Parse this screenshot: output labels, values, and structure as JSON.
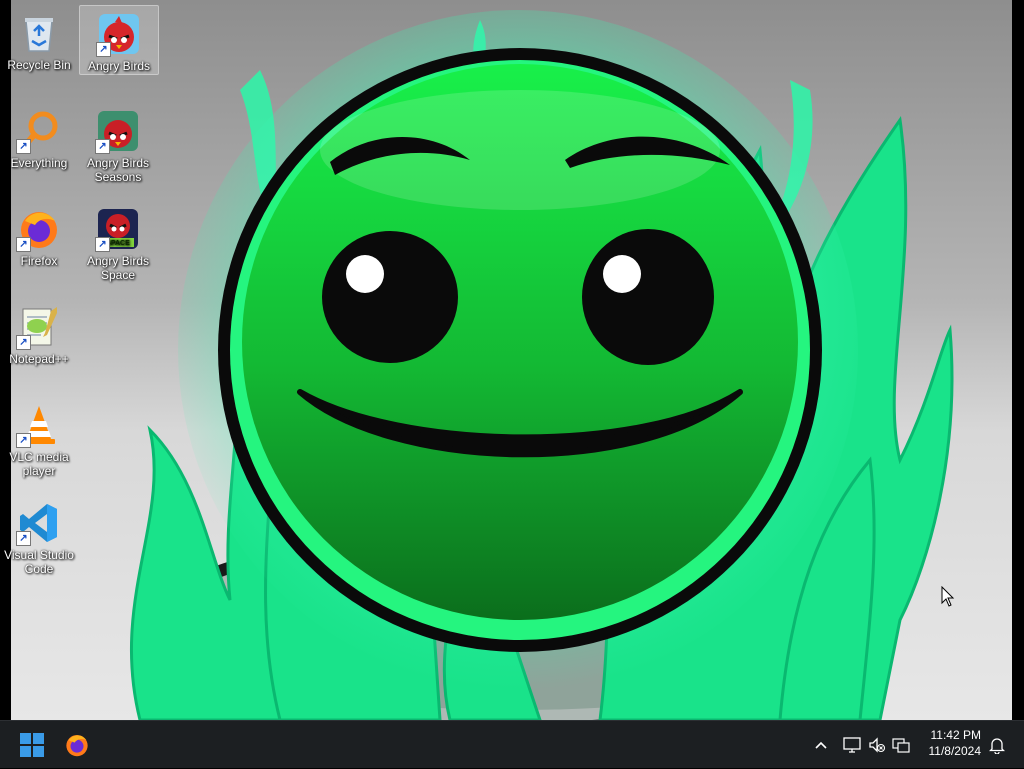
{
  "desktop": {
    "icons": [
      {
        "label": "Recycle Bin",
        "icon": "recycle-bin-icon",
        "shortcut": false,
        "selected": false
      },
      {
        "label": "Angry Birds",
        "icon": "angry-birds-icon",
        "shortcut": true,
        "selected": true
      },
      {
        "label": "Everything",
        "icon": "everything-search-icon",
        "shortcut": true,
        "selected": false
      },
      {
        "label": "Angry Birds Seasons",
        "icon": "angry-birds-seasons-icon",
        "shortcut": true,
        "selected": false
      },
      {
        "label": "Firefox",
        "icon": "firefox-icon",
        "shortcut": true,
        "selected": false
      },
      {
        "label": "Angry Birds Space",
        "icon": "angry-birds-space-icon",
        "shortcut": true,
        "selected": false
      },
      {
        "label": "Notepad++",
        "icon": "notepad-plus-plus-icon",
        "shortcut": true,
        "selected": false
      },
      {
        "label": "VLC media player",
        "icon": "vlc-icon",
        "shortcut": true,
        "selected": false
      },
      {
        "label": "Visual Studio Code",
        "icon": "vscode-icon",
        "shortcut": true,
        "selected": false
      }
    ],
    "wallpaper": {
      "subject": "green-smiley-face-in-flames",
      "colors": {
        "face": "#10c23a",
        "flame": "#16e07a",
        "outline": "#0a0a0a"
      }
    },
    "shortcut_arrow": "↗",
    "space_badge_text": "SPACE"
  },
  "taskbar": {
    "start_icon": "windows-start-icon",
    "pinned": [
      {
        "label": "Firefox",
        "icon": "firefox-icon"
      }
    ],
    "tray": {
      "chevron": "^",
      "icons": [
        "network-icon",
        "volume-muted-icon",
        "language-icon"
      ],
      "time": "11:42 PM",
      "date": "11/8/2024",
      "notification_icon": "bell-icon"
    },
    "colors": {
      "background": "#1c1f22",
      "start_blue": "#3a9be8"
    }
  }
}
